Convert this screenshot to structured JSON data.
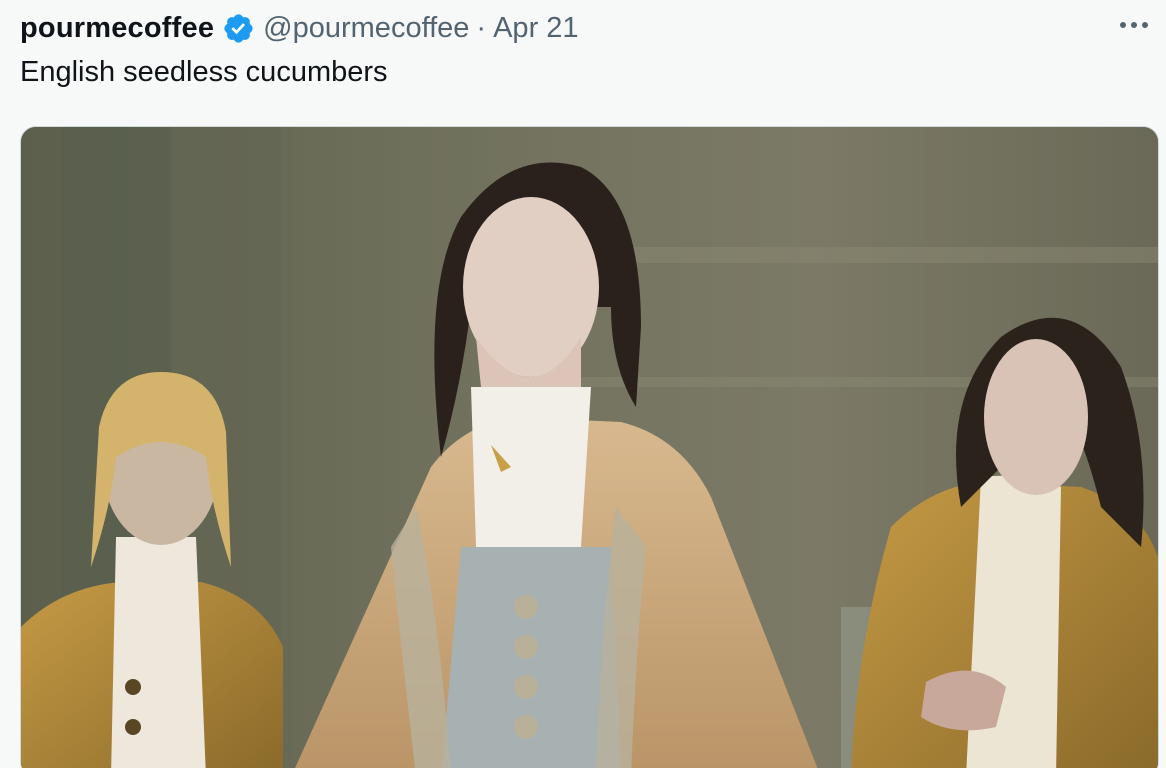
{
  "tweet": {
    "author_name": "pourmecoffee",
    "handle": "@pourmecoffee",
    "separator": "·",
    "date": "Apr 21",
    "text": "English seedless cucumbers"
  },
  "icons": {
    "verified": "verified-badge-icon",
    "more": "more-options-icon"
  },
  "colors": {
    "verified_blue": "#1d9bf0",
    "text_primary": "#0f1419",
    "text_secondary": "#536471",
    "background": "#f7f9f9"
  }
}
